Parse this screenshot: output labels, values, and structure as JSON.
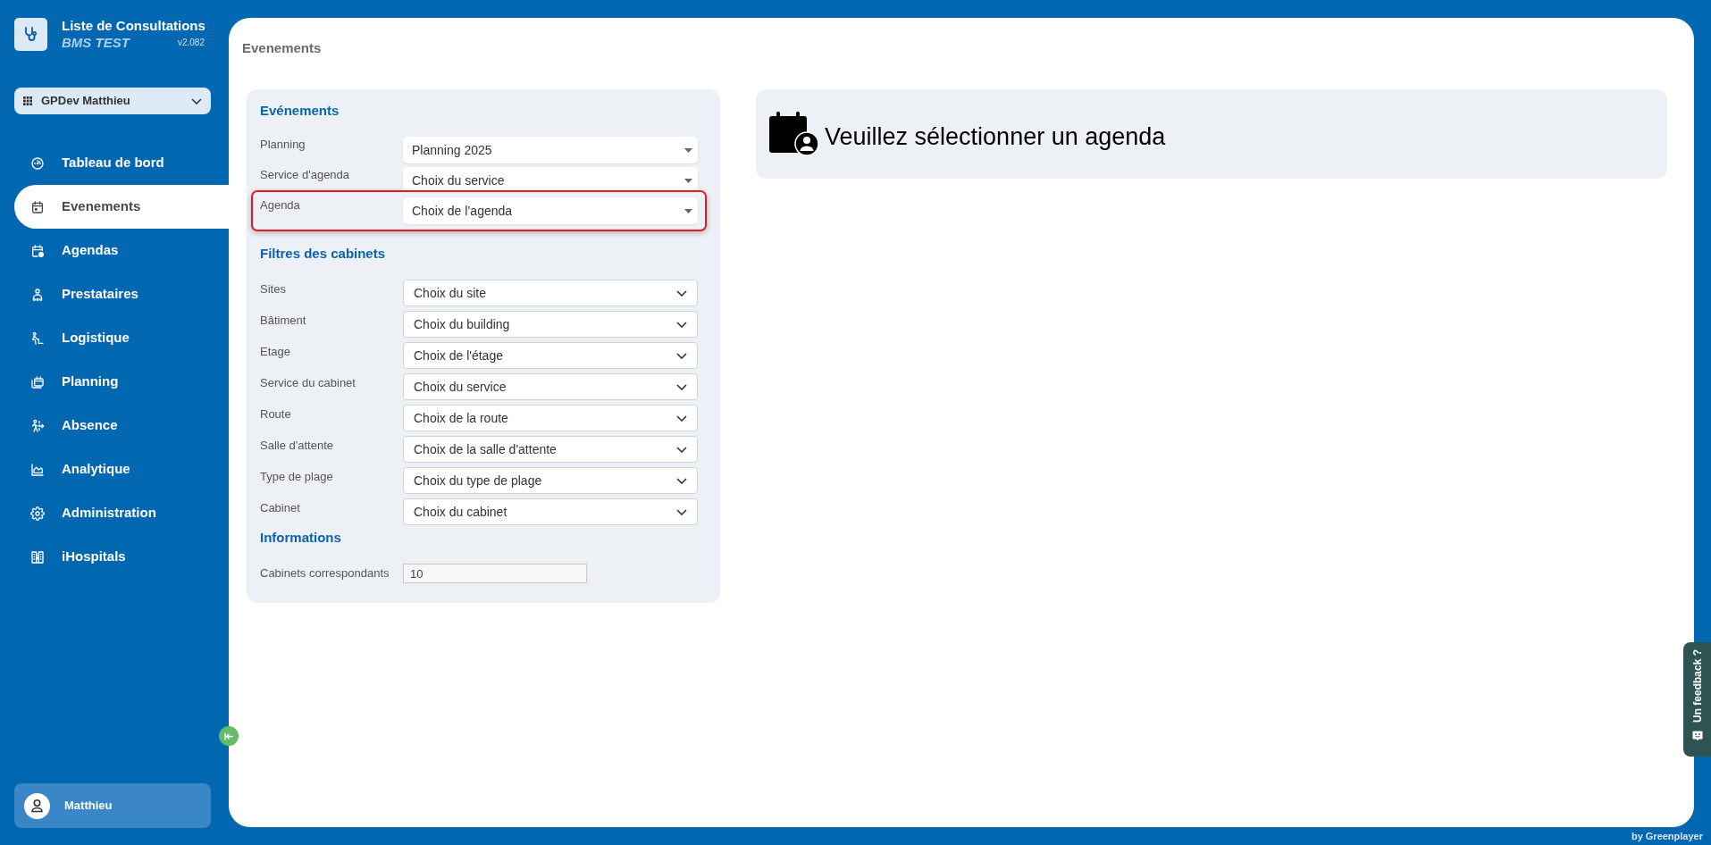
{
  "app": {
    "title": "Liste de Consultations",
    "subtitle": "BMS TEST",
    "version": "v2.082"
  },
  "account_selector": {
    "value": "GPDev Matthieu"
  },
  "sidebar": {
    "items": [
      {
        "label": "Tableau de bord",
        "selected": false
      },
      {
        "label": "Evenements",
        "selected": true
      },
      {
        "label": "Agendas",
        "selected": false
      },
      {
        "label": "Prestataires",
        "selected": false
      },
      {
        "label": "Logistique",
        "selected": false
      },
      {
        "label": "Planning",
        "selected": false
      },
      {
        "label": "Absence",
        "selected": false
      },
      {
        "label": "Analytique",
        "selected": false
      },
      {
        "label": "Administration",
        "selected": false
      },
      {
        "label": "iHospitals",
        "selected": false
      }
    ]
  },
  "user": {
    "name": "Matthieu"
  },
  "page": {
    "title": "Evenements"
  },
  "events_form": {
    "heading": "Evénements",
    "fields": [
      {
        "label": "Planning",
        "value": "Planning 2025",
        "highlighted": false
      },
      {
        "label": "Service d'agenda",
        "value": "Choix du service",
        "highlighted": false
      },
      {
        "label": "Agenda",
        "value": "Choix de l’agenda",
        "highlighted": true
      }
    ]
  },
  "cabinet_filters": {
    "heading": "Filtres des cabinets",
    "fields": [
      {
        "label": "Sites",
        "value": "Choix du site"
      },
      {
        "label": "Bâtiment",
        "value": "Choix du building"
      },
      {
        "label": "Etage",
        "value": "Choix de l'étage"
      },
      {
        "label": "Service du cabinet",
        "value": "Choix du service"
      },
      {
        "label": "Route",
        "value": "Choix de la route"
      },
      {
        "label": "Salle d'attente",
        "value": "Choix de la salle d'attente"
      },
      {
        "label": "Type de plage",
        "value": "Choix du type de plage"
      },
      {
        "label": "Cabinet",
        "value": "Choix du cabinet"
      }
    ]
  },
  "information": {
    "heading": "Informations",
    "fields": [
      {
        "label": "Cabinets correspondants",
        "value": "10",
        "disabled": true
      }
    ]
  },
  "agenda_panel": {
    "message": "Veuillez sélectionner un agenda"
  },
  "feedback_tab": {
    "label": "Un feedback ?"
  },
  "footer": {
    "credit": "by Greenplayer"
  }
}
